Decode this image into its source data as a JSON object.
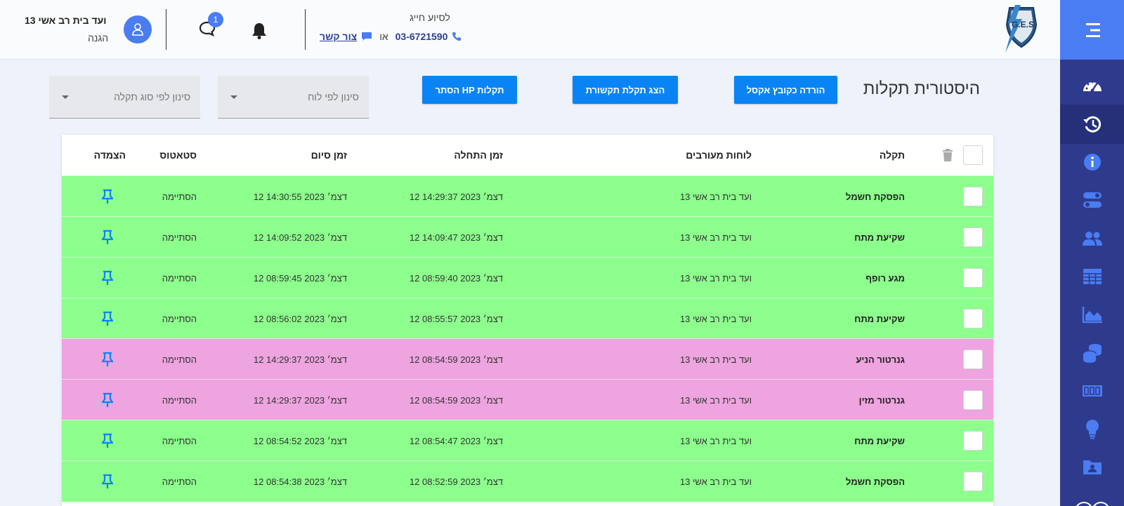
{
  "header": {
    "user": {
      "name": "ועד בית רב אשי 13",
      "role": "הגנה",
      "avatar_icon": "user-icon"
    },
    "notifications": {
      "chat_badge": "1",
      "chat_icon": "chat-icon",
      "bell_icon": "bell-icon"
    },
    "support": {
      "title": "לסיוע חייג",
      "phone": "03-6721590",
      "or": "או",
      "contact_label": "צור קשר"
    },
    "logo_text": "G.E.S"
  },
  "sidebar": {
    "items": [
      {
        "icon": "dashboard-icon"
      },
      {
        "icon": "history-icon",
        "active": true
      },
      {
        "icon": "info-icon"
      },
      {
        "icon": "toggles-icon"
      },
      {
        "icon": "users-icon"
      },
      {
        "icon": "table-icon"
      },
      {
        "icon": "area-chart-icon"
      },
      {
        "icon": "database-icon"
      },
      {
        "icon": "counter-icon"
      },
      {
        "icon": "lightbulb-icon"
      },
      {
        "icon": "folder-user-icon"
      }
    ]
  },
  "toolbar": {
    "title": "היסטורית תקלות",
    "download_excel": "הורדה כקובץ אקסל",
    "show_comm_fault": "הצג תקלת תקשורת",
    "hide_hp_faults": "הסתר HP תקלות",
    "filter_board": "סינון לפי לוח",
    "filter_fault_type": "סינון לפי סוג תקלה"
  },
  "table": {
    "headers": {
      "fault": "תקלה",
      "boards": "לוחות מעורבים",
      "start": "זמן התחלה",
      "end": "זמן סיום",
      "status": "סטאטוס",
      "pin": "הצמדה"
    },
    "colors": {
      "green": "#8cff8c",
      "pink": "#eda4df",
      "pin": "#0a84f5"
    },
    "rows": [
      {
        "fault": "הפסקת חשמל",
        "boards": "ועד בית  רב אשי 13",
        "start": "12 דצמ׳ 2023 14:29:37",
        "end": "12 דצמ׳ 2023 14:30:55",
        "status": "הסתיימה",
        "color": "green"
      },
      {
        "fault": "שקיעת מתח",
        "boards": "ועד בית  רב אשי 13",
        "start": "12 דצמ׳ 2023 14:09:47",
        "end": "12 דצמ׳ 2023 14:09:52",
        "status": "הסתיימה",
        "color": "green"
      },
      {
        "fault": "מגע רופף",
        "boards": "ועד בית  רב אשי 13",
        "start": "12 דצמ׳ 2023 08:59:40",
        "end": "12 דצמ׳ 2023 08:59:45",
        "status": "הסתיימה",
        "color": "green"
      },
      {
        "fault": "שקיעת מתח",
        "boards": "ועד בית  רב אשי 13",
        "start": "12 דצמ׳ 2023 08:55:57",
        "end": "12 דצמ׳ 2023 08:56:02",
        "status": "הסתיימה",
        "color": "green"
      },
      {
        "fault": "גנרטור הניע",
        "boards": "ועד בית  רב אשי 13",
        "start": "12 דצמ׳ 2023 08:54:59",
        "end": "12 דצמ׳ 2023 14:29:37",
        "status": "הסתיימה",
        "color": "pink"
      },
      {
        "fault": "גנרטור מזין",
        "boards": "ועד בית  רב אשי 13",
        "start": "12 דצמ׳ 2023 08:54:59",
        "end": "12 דצמ׳ 2023 14:29:37",
        "status": "הסתיימה",
        "color": "pink"
      },
      {
        "fault": "שקיעת מתח",
        "boards": "ועד בית  רב אשי 13",
        "start": "12 דצמ׳ 2023 08:54:47",
        "end": "12 דצמ׳ 2023 08:54:52",
        "status": "הסתיימה",
        "color": "green"
      },
      {
        "fault": "הפסקת חשמל",
        "boards": "ועד בית  רב אשי 13",
        "start": "12 דצמ׳ 2023 08:52:59",
        "end": "12 דצמ׳ 2023 08:54:38",
        "status": "הסתיימה",
        "color": "green"
      }
    ]
  }
}
